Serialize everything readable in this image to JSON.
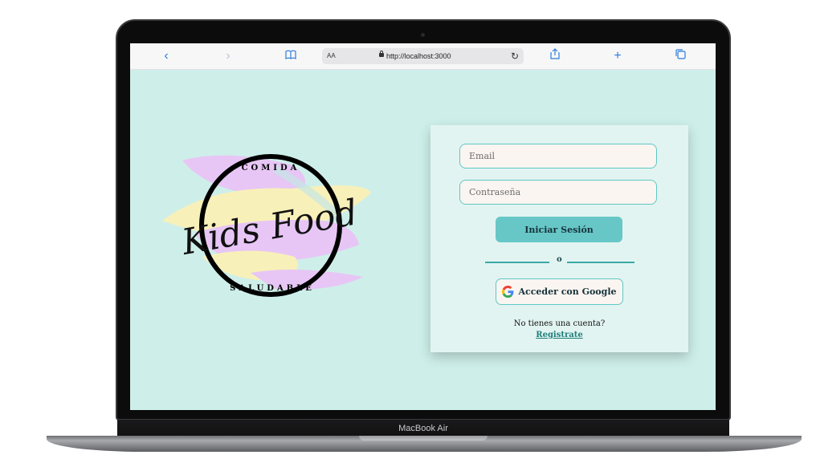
{
  "device": {
    "label": "MacBook Air"
  },
  "browser": {
    "text_size_label": "AA",
    "url": "http://localhost:3000",
    "icons": [
      "back-icon",
      "forward-icon",
      "bookmarks-icon",
      "lock-icon",
      "reload-icon",
      "share-icon",
      "new-tab-icon",
      "tabs-icon"
    ]
  },
  "logo": {
    "top_text": "COMIDA",
    "main_text": "Kids Food",
    "bottom_text": "SALUDABLE",
    "colors": {
      "purple": "#e7c6f5",
      "yellow": "#f8f0b9",
      "ring": "#000000"
    }
  },
  "login": {
    "email_placeholder": "Email",
    "password_placeholder": "Contraseña",
    "login_button": "Iniciar Sesión",
    "separator": "o",
    "google_button": "Acceder con Google",
    "no_account_text": "No tienes una cuenta?",
    "register_link": "Registrate"
  },
  "colors": {
    "page_bg": "#ceefe9",
    "card_bg": "#e2f4f1",
    "accent": "#67c7c7",
    "link": "#1f7f7b"
  }
}
